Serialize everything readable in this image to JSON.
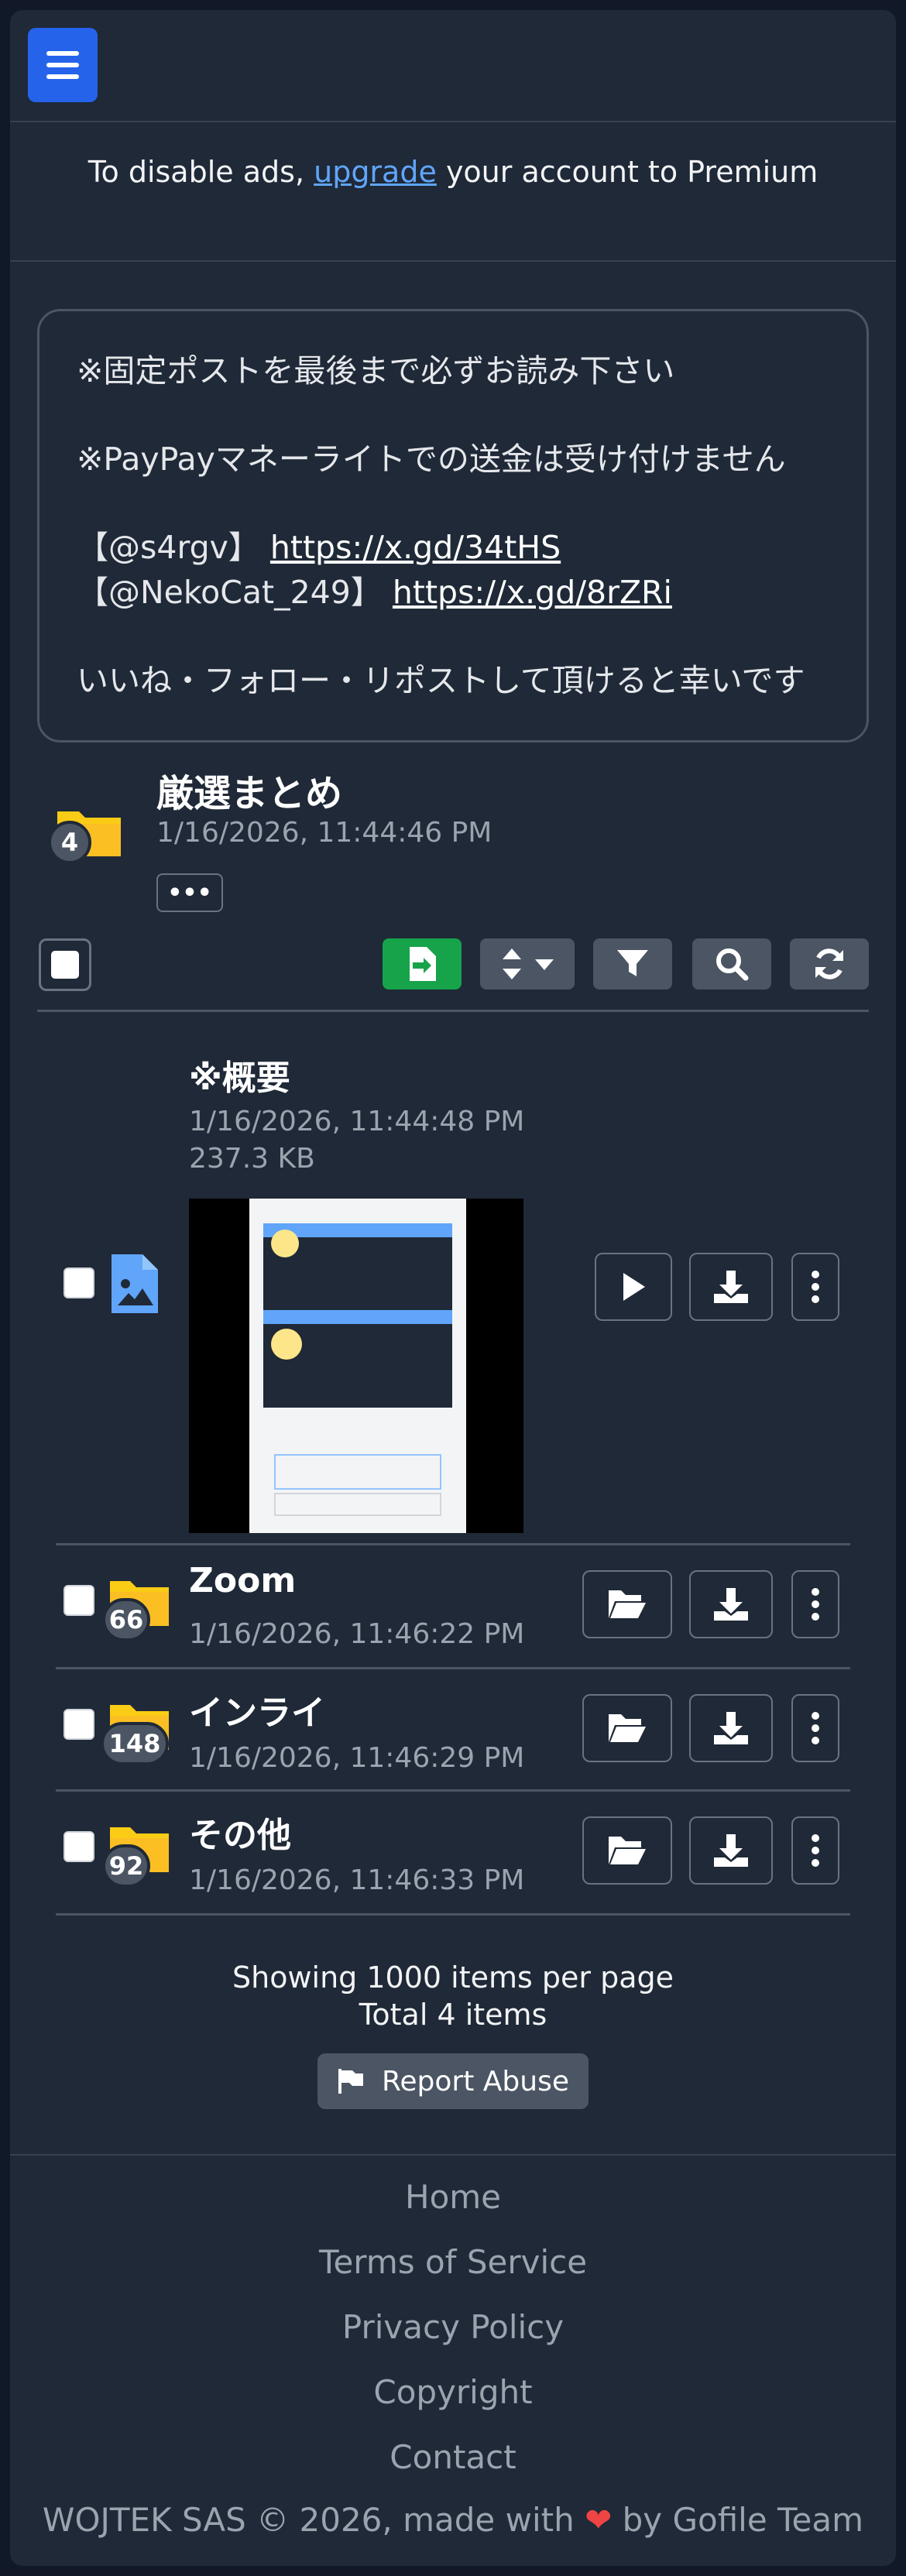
{
  "header": {
    "menu_icon": "hamburger-icon"
  },
  "ads": {
    "prefix": "To disable ads, ",
    "link": "upgrade",
    "suffix": " your account to Premium"
  },
  "notice": {
    "line1": "※固定ポストを最後まで必ずお読み下さい",
    "line2": "※PayPayマネーライトでの送金は受け付けません",
    "link1_label": "【@s4rgv】",
    "link1_url": "https://x.gd/34tHS",
    "link2_label": "【@NekoCat_249】",
    "link2_url": "https://x.gd/8rZRi",
    "line5": "いいね・フォロー・リポストして頂けると幸いです"
  },
  "folder": {
    "title": "厳選まとめ",
    "date": "1/16/2026, 11:44:46 PM",
    "count": "4",
    "more": "•••"
  },
  "items": [
    {
      "type": "image",
      "title": "※概要",
      "date": "1/16/2026, 11:44:48 PM",
      "size": "237.3 KB"
    },
    {
      "type": "folder",
      "title": "Zoom",
      "date": "1/16/2026, 11:46:22 PM",
      "count": "66"
    },
    {
      "type": "folder",
      "title": "インライ",
      "date": "1/16/2026, 11:46:29 PM",
      "count": "148"
    },
    {
      "type": "folder",
      "title": "その他",
      "date": "1/16/2026, 11:46:33 PM",
      "count": "92"
    }
  ],
  "footer": {
    "per_page": "Showing 1000 items per page",
    "total": "Total 4 items",
    "report": "Report Abuse",
    "links": [
      "Home",
      "Terms of Service",
      "Privacy Policy",
      "Copyright",
      "Contact"
    ],
    "copyright_prefix": "WOJTEK SAS © 2026, made with ",
    "heart": "❤",
    "copyright_suffix": " by Gofile Team"
  },
  "colors": {
    "accent": "#2563eb",
    "folder": "#facc15",
    "import": "#16a34a",
    "image_icon": "#3b82f6"
  }
}
